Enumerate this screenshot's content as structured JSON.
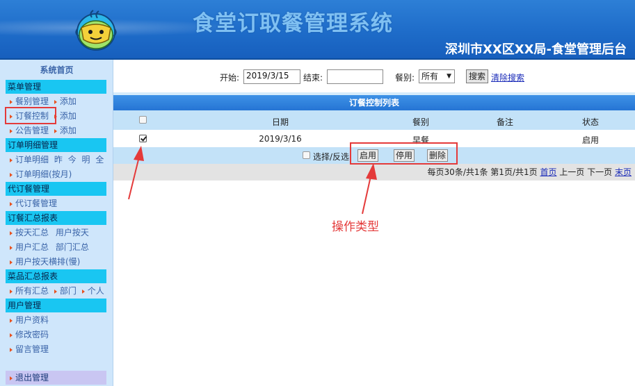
{
  "header": {
    "title": "食堂订取餐管理系统",
    "subtitle": "深圳市XX区XX局-食堂管理后台",
    "logo_icon": "chef-pot-logo-icon"
  },
  "sidebar": {
    "home": "系统首页",
    "groups": [
      {
        "label": "菜单管理"
      },
      {
        "label": "订单明细管理"
      },
      {
        "label": "代订餐管理"
      },
      {
        "label": "订餐汇总报表"
      },
      {
        "label": "菜品汇总报表"
      },
      {
        "label": "用户管理"
      }
    ],
    "items": {
      "meal_type_mgmt": "餐别管理",
      "add": "添加",
      "order_control": "订餐控制",
      "notice_mgmt": "公告管理",
      "order_detail": "订单明细",
      "yesterday": "昨",
      "today": "今",
      "tomorrow": "明",
      "all": "全",
      "order_detail_monthly": "订单明细(按月)",
      "proxy_order_mgmt": "代订餐管理",
      "daily_summary": "按天汇总",
      "user_daily": "用户按天",
      "user_summary": "用户汇总",
      "dept_summary": "部门汇总",
      "user_daily_horizontal": "用户按天横排(慢)",
      "all_summary": "所有汇总",
      "dept": "部门",
      "individual": "个人",
      "user_profile": "用户资料",
      "change_password": "修改密码",
      "message_mgmt": "留言管理"
    },
    "logout": "退出管理",
    "arrow_color": "#e8521f"
  },
  "search": {
    "start_label": "开始:",
    "start_value": "2019/3/15",
    "end_label": "结束:",
    "end_value": "",
    "meal_label": "餐别:",
    "meal_selected": "所有",
    "search_button": "搜索",
    "clear_link": "清除搜索"
  },
  "table": {
    "title": "订餐控制列表",
    "columns": [
      "日期",
      "餐别",
      "备注",
      "状态"
    ],
    "rows": [
      {
        "checked": true,
        "date": "2019/3/16",
        "meal": "早餐",
        "note": "",
        "status": "启用"
      }
    ],
    "select_invert": "选择/反选",
    "actions": {
      "enable": "启用",
      "disable": "停用",
      "delete": "删除"
    }
  },
  "pager": {
    "summary": "每页30条/共1条 第1页/共1页",
    "first": "首页",
    "prev": "上一页",
    "next": "下一页",
    "last": "末页"
  },
  "annotation": {
    "label": "操作类型",
    "color": "#e43a3a"
  }
}
